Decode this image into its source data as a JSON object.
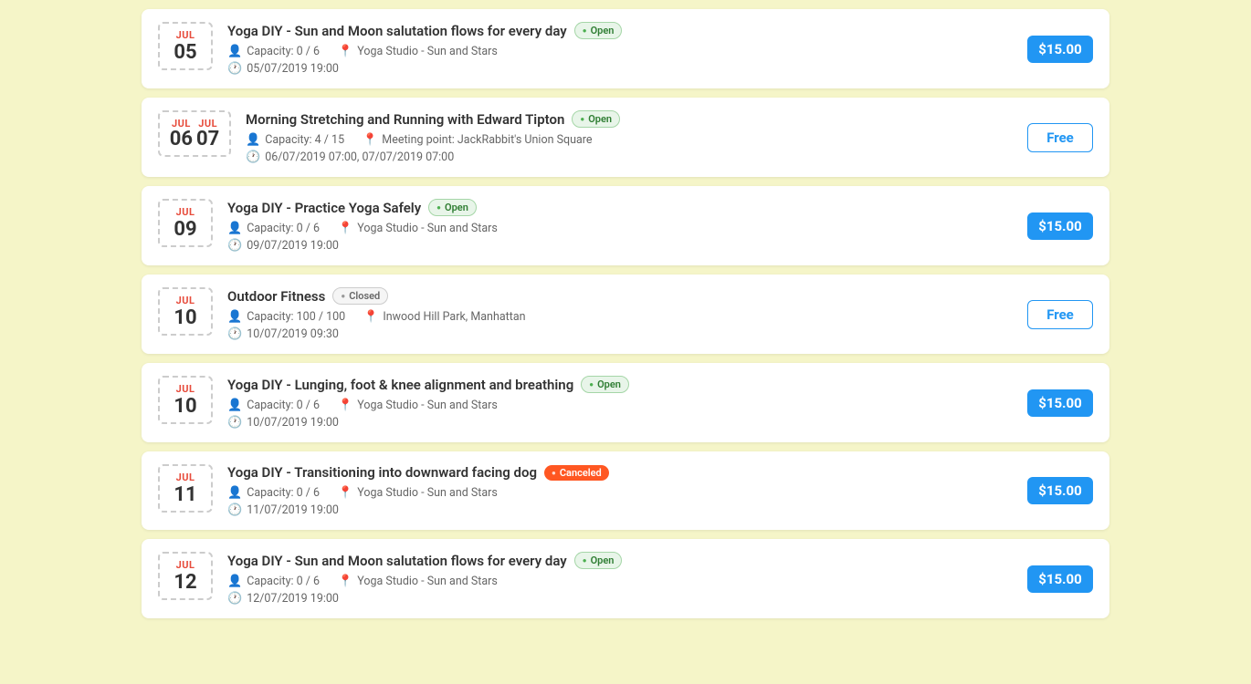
{
  "events": [
    {
      "id": 1,
      "month": "JUL",
      "day": "05",
      "multi": false,
      "title": "Yoga DIY - Sun and Moon salutation flows for every day",
      "status": "open",
      "status_label": "Open",
      "capacity": "Capacity: 0 / 6",
      "location": "Yoga Studio - Sun and Stars",
      "datetime": "05/07/2019 19:00",
      "price_type": "paid",
      "price": "$15.00"
    },
    {
      "id": 2,
      "month1": "JUL",
      "month2": "JUL",
      "day1": "06",
      "day2": "07",
      "multi": true,
      "title": "Morning Stretching and Running with Edward Tipton",
      "status": "open",
      "status_label": "Open",
      "capacity": "Capacity: 4 / 15",
      "location": "Meeting point: JackRabbit's Union Square",
      "datetime": "06/07/2019 07:00, 07/07/2019 07:00",
      "price_type": "free",
      "price": "Free"
    },
    {
      "id": 3,
      "month": "JUL",
      "day": "09",
      "multi": false,
      "title": "Yoga DIY - Practice Yoga Safely",
      "status": "open",
      "status_label": "Open",
      "capacity": "Capacity: 0 / 6",
      "location": "Yoga Studio - Sun and Stars",
      "datetime": "09/07/2019 19:00",
      "price_type": "paid",
      "price": "$15.00"
    },
    {
      "id": 4,
      "month": "JUL",
      "day": "10",
      "multi": false,
      "title": "Outdoor Fitness",
      "status": "closed",
      "status_label": "Closed",
      "capacity": "Capacity: 100 / 100",
      "location": "Inwood Hill Park, Manhattan",
      "datetime": "10/07/2019 09:30",
      "price_type": "free",
      "price": "Free"
    },
    {
      "id": 5,
      "month": "JUL",
      "day": "10",
      "multi": false,
      "title": "Yoga DIY - Lunging, foot & knee alignment and breathing",
      "status": "open",
      "status_label": "Open",
      "capacity": "Capacity: 0 / 6",
      "location": "Yoga Studio - Sun and Stars",
      "datetime": "10/07/2019 19:00",
      "price_type": "paid",
      "price": "$15.00"
    },
    {
      "id": 6,
      "month": "JUL",
      "day": "11",
      "multi": false,
      "title": "Yoga DIY - Transitioning into downward facing dog",
      "status": "canceled",
      "status_label": "Canceled",
      "capacity": "Capacity: 0 / 6",
      "location": "Yoga Studio - Sun and Stars",
      "datetime": "11/07/2019 19:00",
      "price_type": "paid",
      "price": "$15.00"
    },
    {
      "id": 7,
      "month": "JUL",
      "day": "12",
      "multi": false,
      "title": "Yoga DIY - Sun and Moon salutation flows for every day",
      "status": "open",
      "status_label": "Open",
      "capacity": "Capacity: 0 / 6",
      "location": "Yoga Studio - Sun and Stars",
      "datetime": "12/07/2019 19:00",
      "price_type": "paid",
      "price": "$15.00"
    }
  ]
}
